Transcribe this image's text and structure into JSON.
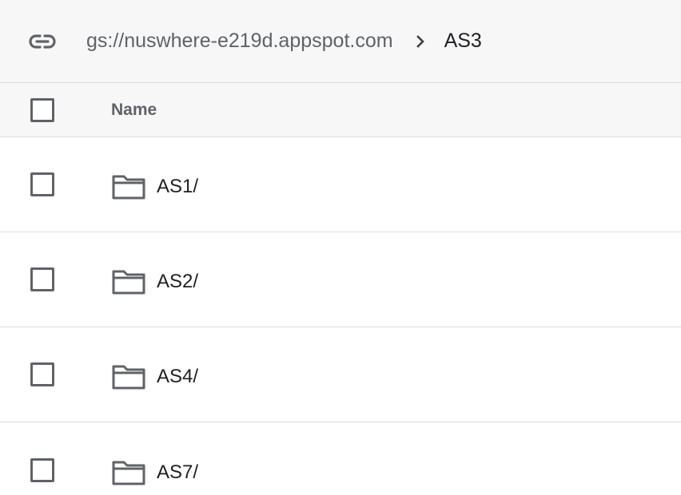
{
  "breadcrumb": {
    "link_icon": "link-icon",
    "root": "gs://nuswhere-e219d.appspot.com",
    "separator_icon": "chevron-right-icon",
    "current": "AS3"
  },
  "table": {
    "columns": [
      "Name"
    ],
    "rows": [
      {
        "name": "AS1/",
        "icon": "folder-icon"
      },
      {
        "name": "AS2/",
        "icon": "folder-icon"
      },
      {
        "name": "AS4/",
        "icon": "folder-icon"
      },
      {
        "name": "AS7/",
        "icon": "folder-icon"
      }
    ]
  },
  "colors": {
    "header_bg": "#f7f7f7",
    "divider": "#dadce0",
    "muted_text": "#5f6368",
    "text": "#202124"
  }
}
